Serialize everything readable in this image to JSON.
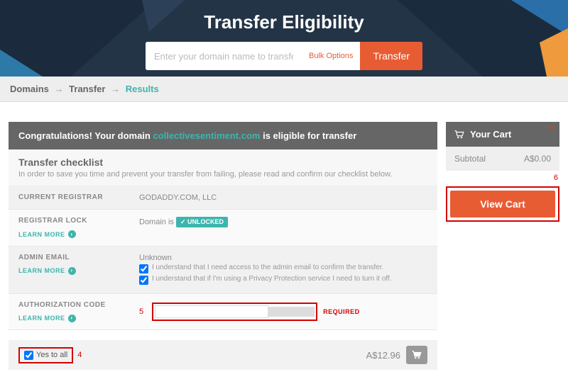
{
  "hero": {
    "title": "Transfer Eligibility",
    "placeholder": "Enter your domain name to transfer",
    "bulk": "Bulk Options",
    "button": "Transfer"
  },
  "breadcrumb": {
    "a": "Domains",
    "b": "Transfer",
    "c": "Results"
  },
  "banner": {
    "pre": "Congratulations! Your domain ",
    "domain": "collectivesentiment.com",
    "post": " is eligible for transfer"
  },
  "checklist": {
    "title": "Transfer checklist",
    "desc": "In order to save you time and prevent your transfer from failing, please read and confirm our checklist below.",
    "learn_more": "LEARN MORE"
  },
  "rows": {
    "registrar": {
      "label": "CURRENT REGISTRAR",
      "value": "GODADDY.COM, LLC"
    },
    "lock": {
      "label": "REGISTRAR LOCK",
      "pre": "Domain is ",
      "badge": "UNLOCKED"
    },
    "admin": {
      "label": "ADMIN EMAIL",
      "value": "Unknown",
      "c1": "I understand that I need access to the admin email to confirm the transfer.",
      "c2": "I understand that if I'm using a Privacy Protection service I need to turn it off."
    },
    "auth": {
      "label": "AUTHORIZATION CODE",
      "required": "REQUIRED"
    }
  },
  "footer": {
    "yes_all": "Yes to all",
    "price": "A$12.96"
  },
  "cart": {
    "title": "Your Cart",
    "subtotal_label": "Subtotal",
    "subtotal_value": "A$0.00",
    "view": "View Cart"
  },
  "markers": {
    "m4": "4",
    "m5": "5",
    "m6": "6"
  }
}
